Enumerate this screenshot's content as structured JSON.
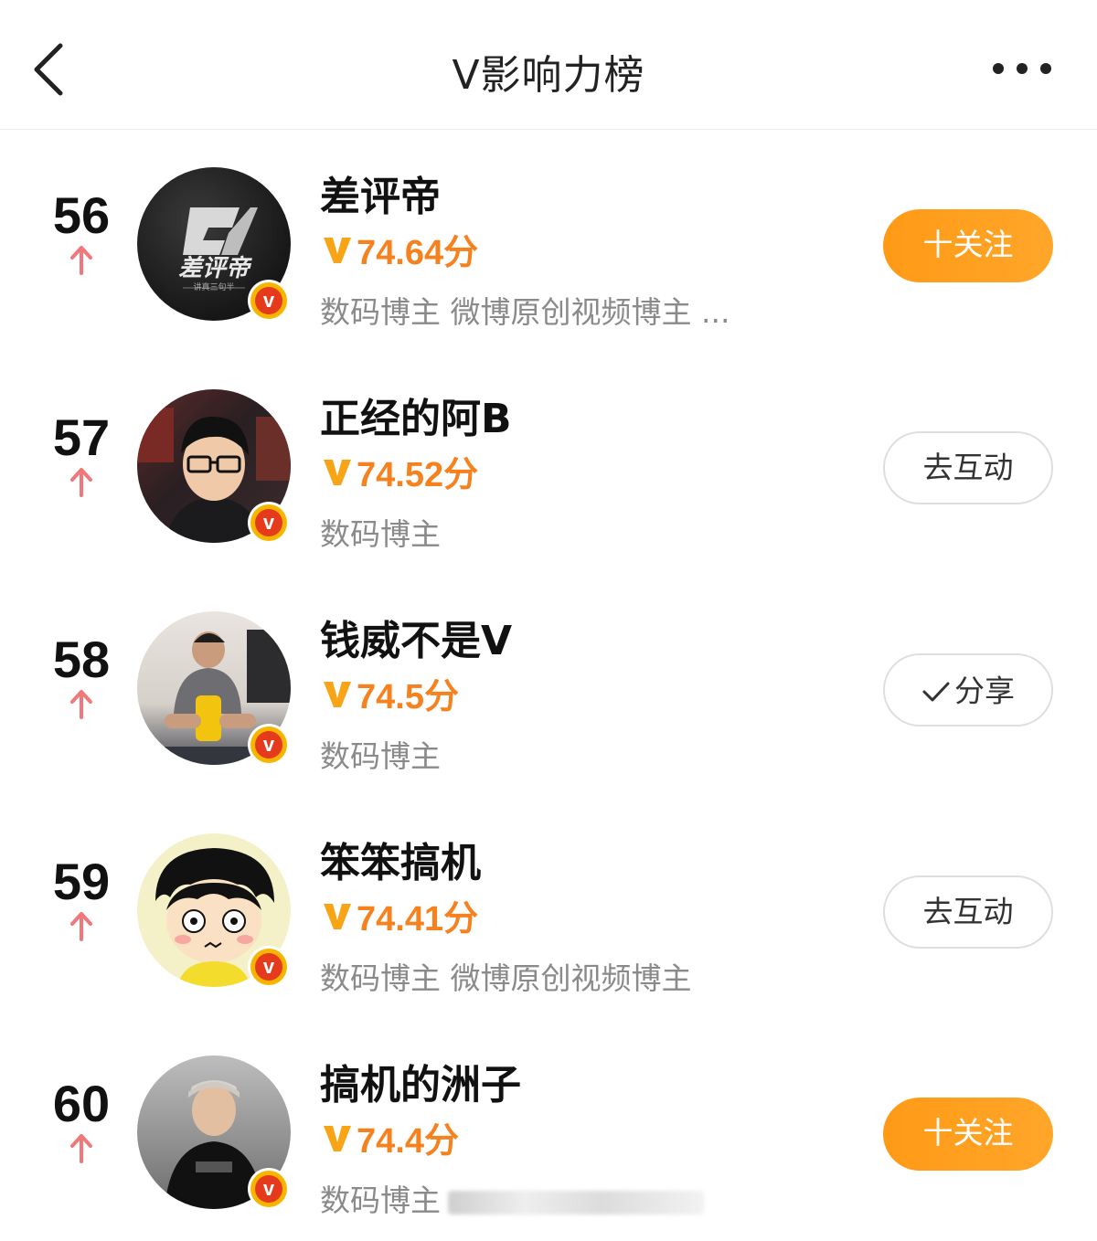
{
  "header": {
    "back_icon": "chevron-left-icon",
    "title": "V影响力榜",
    "more_icon": "more-dots-icon"
  },
  "colors": {
    "accent_orange": "#f5821f",
    "button_orange": "#ff9a16",
    "rank_up_arrow": "#f0787a",
    "verified_badge": "#e63a1c"
  },
  "list": [
    {
      "rank": "56",
      "trend_icon": "arrow-up-icon",
      "name": "差评帝",
      "score": "74.64分",
      "tags": "数码博主 微博原创视频博主 ...",
      "button_label": "十关注",
      "button_style": "primary",
      "avatar_text": "差评帝",
      "avatar_sub": "讲真三句半"
    },
    {
      "rank": "57",
      "trend_icon": "arrow-up-icon",
      "name": "正经的阿B",
      "score": "74.52分",
      "tags": "数码博主",
      "button_label": "去互动",
      "button_style": "outline"
    },
    {
      "rank": "58",
      "trend_icon": "arrow-up-icon",
      "name": "钱威不是V",
      "score": "74.5分",
      "tags": "数码博主",
      "button_label": "分享",
      "button_style": "outline"
    },
    {
      "rank": "59",
      "trend_icon": "arrow-up-icon",
      "name": "笨笨搞机",
      "score": "74.41分",
      "tags": "数码博主 微博原创视频博主",
      "button_label": "去互动",
      "button_style": "outline"
    },
    {
      "rank": "60",
      "trend_icon": "arrow-up-icon",
      "name": "搞机的洲子",
      "score": "74.4分",
      "tags": "数码博主",
      "button_label": "十关注",
      "button_style": "primary"
    }
  ]
}
